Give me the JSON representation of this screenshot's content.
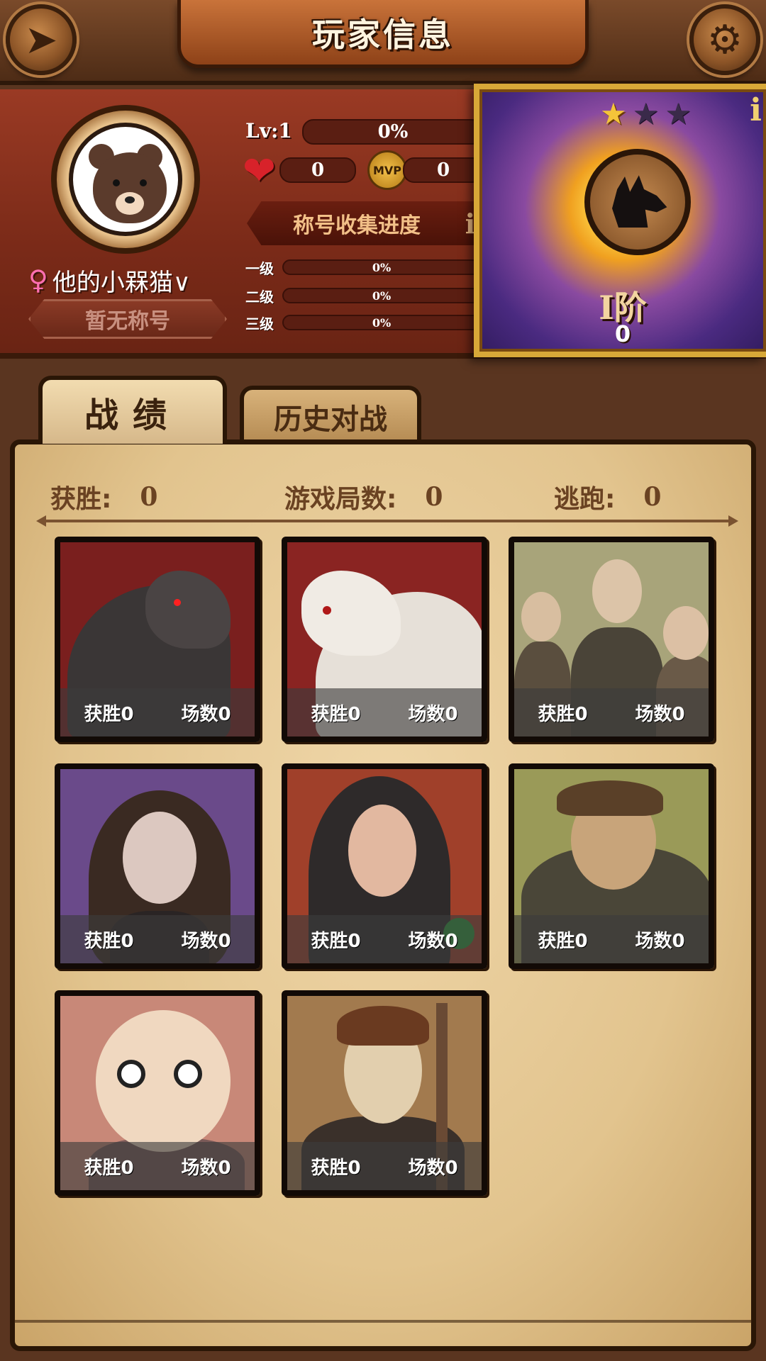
{
  "header": {
    "title": "玩家信息"
  },
  "player": {
    "name": "他的小槑猫∨",
    "gender_symbol": "♀",
    "title_placeholder": "暂无称号",
    "level_label": "Lv:1",
    "exp_percent": "0%",
    "likes": "0",
    "mvp_label": "MVP",
    "mvp_count": "0"
  },
  "title_collection": {
    "heading": "称号收集进度",
    "info": "i",
    "tiers": [
      {
        "label": "一级",
        "percent": "0%",
        "progress": 0
      },
      {
        "label": "二级",
        "percent": "0%",
        "progress": 0
      },
      {
        "label": "三级",
        "percent": "0%",
        "progress": 0
      }
    ]
  },
  "rank": {
    "info": "i",
    "stars_filled": 1,
    "stars_total": 3,
    "name": "Ⅰ阶",
    "points": "0"
  },
  "tabs": [
    {
      "label": "战绩",
      "active": true
    },
    {
      "label": "历史对战",
      "active": false
    }
  ],
  "summary": {
    "wins_label": "获胜:",
    "wins": "0",
    "games_label": "游戏局数:",
    "games": "0",
    "escape_label": "逃跑:",
    "escape": "0"
  },
  "roles": [
    {
      "id": "werewolf",
      "win_label": "获胜0",
      "games_label": "场数0"
    },
    {
      "id": "white-wolf",
      "win_label": "获胜0",
      "games_label": "场数0"
    },
    {
      "id": "villagers",
      "win_label": "获胜0",
      "games_label": "场数0"
    },
    {
      "id": "seer",
      "win_label": "获胜0",
      "games_label": "场数0"
    },
    {
      "id": "witch",
      "win_label": "获胜0",
      "games_label": "场数0"
    },
    {
      "id": "hunter",
      "win_label": "获胜0",
      "games_label": "场数0"
    },
    {
      "id": "idiot",
      "win_label": "获胜0",
      "games_label": "场数0"
    },
    {
      "id": "guard",
      "win_label": "获胜0",
      "games_label": "场数0"
    }
  ],
  "colors": {
    "panel_red": "#7a2a18",
    "parchment": "#e2c48e",
    "rank_gold": "#d8a838",
    "heart_red": "#d8222a",
    "female_pink": "#ff6fb0"
  },
  "icons": [
    "back-arrow-icon",
    "gear-icon",
    "heart-icon",
    "mvp-medal-icon",
    "star-icon",
    "info-icon"
  ]
}
